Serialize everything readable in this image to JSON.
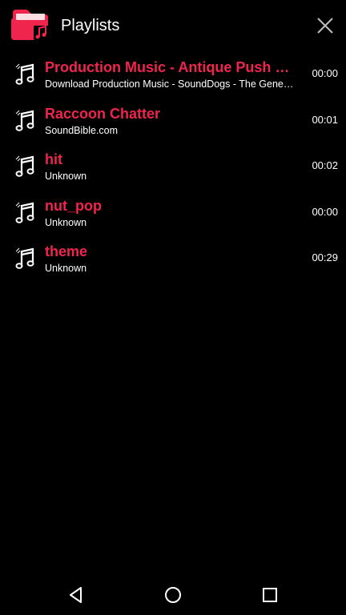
{
  "header": {
    "title": "Playlists",
    "icon": "folder-music-icon",
    "close_icon": "close-icon"
  },
  "tracks": [
    {
      "title": "Production Music - Antique Push Buttons",
      "subtitle": "Download Production Music - SoundDogs - The General Store",
      "duration": "00:00"
    },
    {
      "title": "Raccoon Chatter",
      "subtitle": "SoundBible.com",
      "duration": "00:01"
    },
    {
      "title": "hit",
      "subtitle": "Unknown",
      "duration": "00:02"
    },
    {
      "title": "nut_pop",
      "subtitle": "Unknown",
      "duration": "00:00"
    },
    {
      "title": "theme",
      "subtitle": "Unknown",
      "duration": "00:29"
    }
  ],
  "navbar": {
    "back_icon": "back-triangle-icon",
    "home_icon": "home-circle-icon",
    "recents_icon": "recents-square-icon"
  },
  "colors": {
    "accent": "#f0254e",
    "background": "#000000",
    "text": "#ffffff"
  }
}
